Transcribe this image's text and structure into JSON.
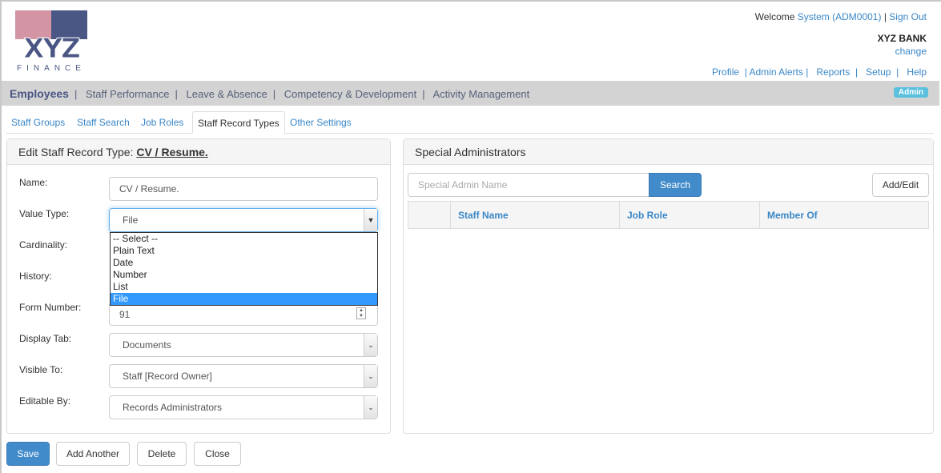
{
  "logo": {
    "text": "XYZ",
    "subtext": "FINANCE",
    "colors": {
      "pink": "#d394a4",
      "blue": "#4a5684"
    }
  },
  "header": {
    "welcome": "Welcome",
    "user": "System (ADM0001)",
    "sep": "|",
    "signout": "Sign Out",
    "org": "XYZ BANK",
    "change": "change",
    "links": [
      "Profile",
      "Admin Alerts",
      "Reports",
      "Setup",
      "Help"
    ]
  },
  "nav": {
    "items": [
      "Employees",
      "Staff Performance",
      "Leave & Absence",
      "Competency & Development",
      "Activity Management"
    ],
    "badge": "Admin"
  },
  "tabs": [
    {
      "label": "Staff Groups"
    },
    {
      "label": "Staff Search"
    },
    {
      "label": "Job Roles"
    },
    {
      "label": "Staff Record Types",
      "active": true
    },
    {
      "label": "Other Settings"
    }
  ],
  "edit": {
    "title": "Edit Staff Record Type:",
    "record": "CV / Resume.",
    "labels": {
      "name": "Name:",
      "value_type": "Value Type:",
      "cardinality": "Cardinality:",
      "history": "History:",
      "form_number": "Form Number:",
      "display_tab": "Display Tab:",
      "visible_to": "Visible To:",
      "editable_by": "Editable By:"
    },
    "name": "CV / Resume.",
    "value_type": "File",
    "value_type_options": [
      "-- Select --",
      "Plain Text",
      "Date",
      "Number",
      "List",
      "File"
    ],
    "form_number": "91",
    "display_tab": "Documents",
    "visible_to": "Staff [Record Owner]",
    "editable_by": "Records Administrators"
  },
  "special": {
    "title": "Special Administrators",
    "search_placeholder": "Special Admin Name",
    "search": "Search",
    "add_edit": "Add/Edit",
    "columns": [
      "",
      "Staff Name",
      "Job Role",
      "Member Of"
    ]
  },
  "actions": {
    "save": "Save",
    "add_another": "Add Another",
    "delete": "Delete",
    "close": "Close"
  }
}
